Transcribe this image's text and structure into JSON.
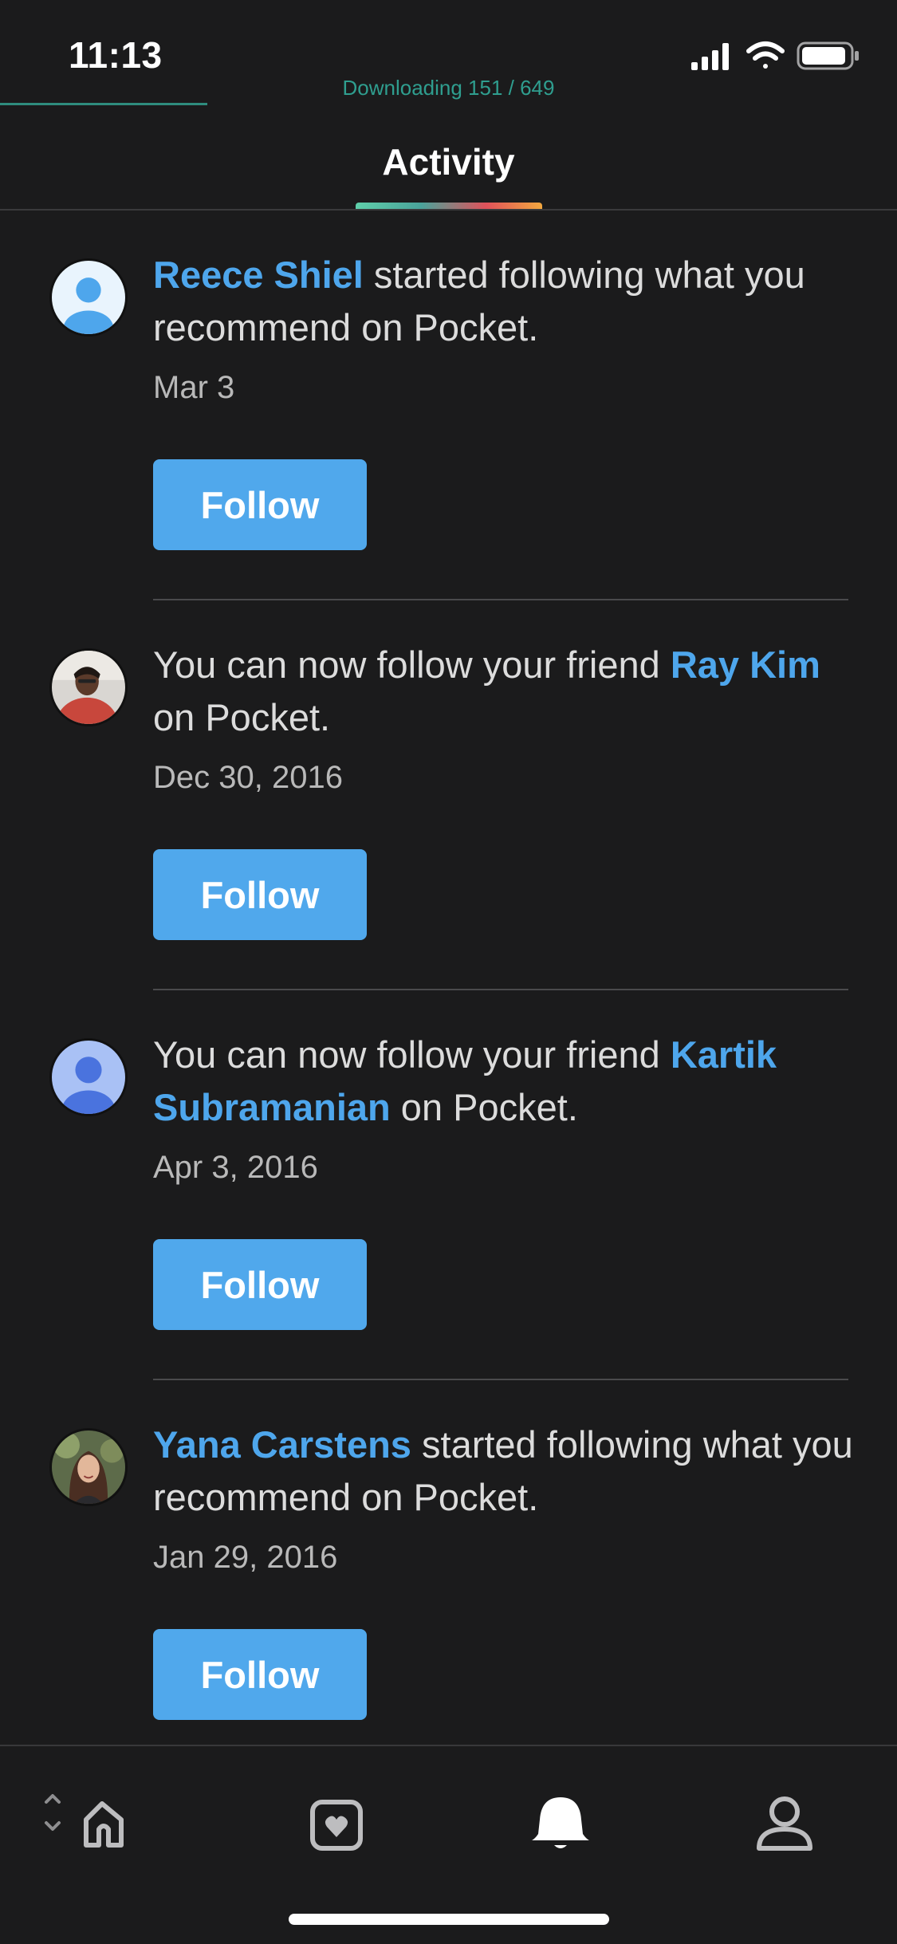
{
  "status_bar": {
    "time": "11:13",
    "icons": [
      "signal-icon",
      "wifi-icon",
      "battery-icon"
    ]
  },
  "download": {
    "status_text": "Downloading 151 / 649",
    "progress": 0.233
  },
  "header": {
    "tab_label": "Activity"
  },
  "colors": {
    "link": "#4ea6ec",
    "follow_button": "#50a8ec",
    "background": "#1b1b1c",
    "download_text": "#2f9e8f"
  },
  "feed": [
    {
      "prefix": "",
      "name": "Reece Shiel",
      "suffix": " started following what you recommend on Pocket.",
      "date": "Mar 3",
      "button": "Follow",
      "avatar": "default-avatar-icon"
    },
    {
      "prefix": "You can now follow your friend ",
      "name": "Ray Kim",
      "suffix": " on Pocket.",
      "date": "Dec 30, 2016",
      "button": "Follow",
      "avatar": "photo-avatar"
    },
    {
      "prefix": "You can now follow your friend ",
      "name": "Kartik Subramanian",
      "suffix": " on Pocket.",
      "date": "Apr 3, 2016",
      "button": "Follow",
      "avatar": "default-avatar-icon"
    },
    {
      "prefix": "",
      "name": "Yana Carstens",
      "suffix": " started following what you recommend on Pocket.",
      "date": "Jan 29, 2016",
      "button": "Follow",
      "avatar": "photo-avatar"
    }
  ],
  "bottom_nav": {
    "items": [
      {
        "icon": "home-icon",
        "active": false
      },
      {
        "icon": "saves-icon",
        "active": false
      },
      {
        "icon": "bell-icon",
        "active": true
      },
      {
        "icon": "profile-icon",
        "active": false
      }
    ]
  }
}
